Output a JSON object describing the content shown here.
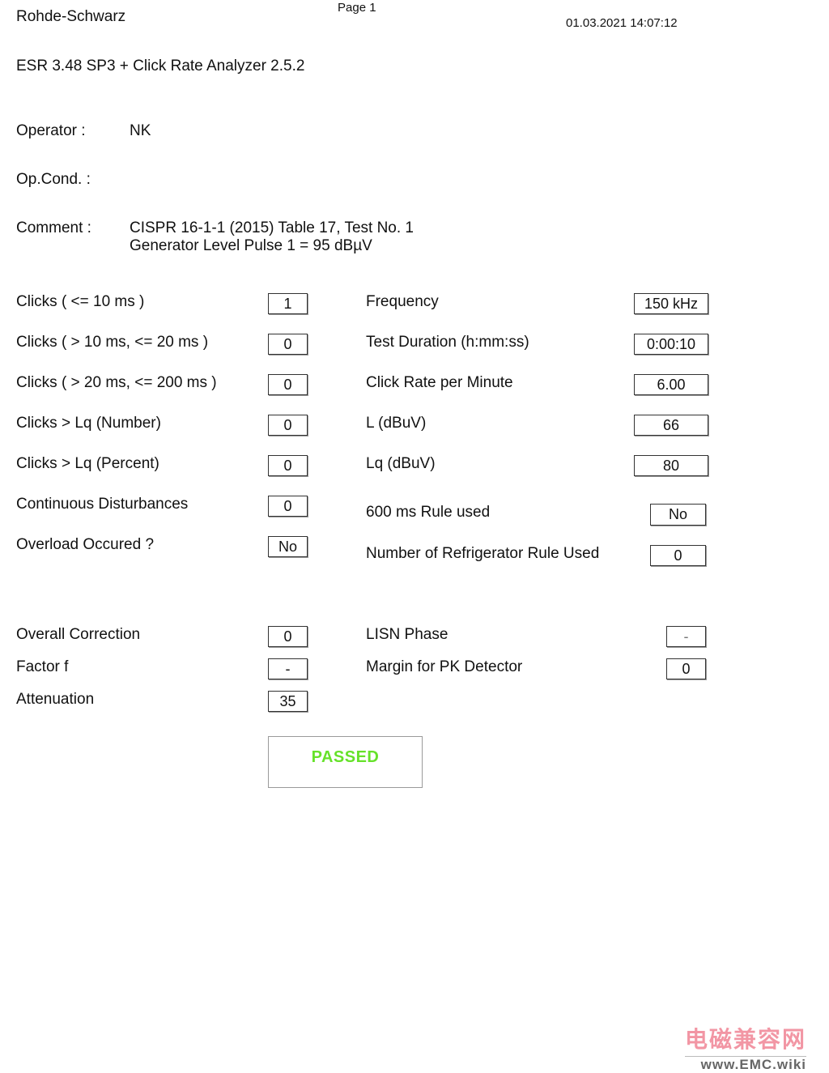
{
  "header": {
    "company": "Rohde-Schwarz",
    "page": "Page 1",
    "datetime": "01.03.2021 14:07:12",
    "software": "ESR 3.48 SP3 + Click Rate Analyzer 2.5.2"
  },
  "info": {
    "operator_label": "Operator :",
    "operator_value": "NK",
    "opcond_label": "Op.Cond. :",
    "comment_label": "Comment :",
    "comment_line1": "CISPR 16-1-1 (2015) Table 17, Test No. 1",
    "comment_line2": "Generator Level Pulse 1 = 95 dBµV"
  },
  "left_fields": [
    {
      "label": "Clicks ( <= 10 ms )",
      "value": "1"
    },
    {
      "label": "Clicks ( > 10 ms, <= 20 ms )",
      "value": "0"
    },
    {
      "label": "Clicks ( > 20 ms, <= 200 ms )",
      "value": "0"
    },
    {
      "label": "Clicks  > Lq (Number)",
      "value": "0"
    },
    {
      "label": "Clicks > Lq (Percent)",
      "value": "0"
    },
    {
      "label": "Continuous Disturbances",
      "value": "0"
    },
    {
      "label": "Overload Occured ?",
      "value": "No"
    }
  ],
  "right_fields": [
    {
      "label": "Frequency",
      "value": "150 kHz"
    },
    {
      "label": "Test Duration (h:mm:ss)",
      "value": "0:00:10"
    },
    {
      "label": "Click Rate per Minute",
      "value": "6.00"
    },
    {
      "label": "L (dBuV)",
      "value": "66"
    },
    {
      "label": "Lq (dBuV)",
      "value": "80"
    },
    {
      "label": "600 ms Rule used",
      "value": "No"
    },
    {
      "label": "Number of Refrigerator Rule Used",
      "value": "0"
    }
  ],
  "corrections_left": [
    {
      "label": "Overall Correction",
      "value": "0"
    },
    {
      "label": "Factor f",
      "value": "-"
    },
    {
      "label": "Attenuation",
      "value": "35"
    }
  ],
  "corrections_right": [
    {
      "label": "LISN Phase",
      "value": "-"
    },
    {
      "label": "Margin for PK Detector",
      "value": "0"
    }
  ],
  "result": {
    "label": "PASSED",
    "color": "#66e22a"
  },
  "watermark": {
    "cn": "电磁兼容网",
    "url": "www.EMC.wiki",
    "color": "#e8415a"
  }
}
